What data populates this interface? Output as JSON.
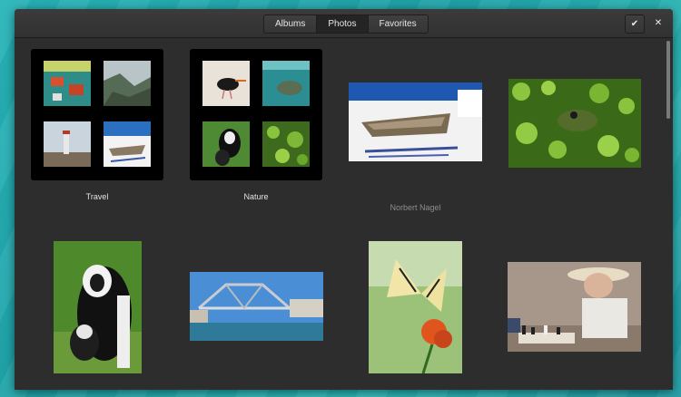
{
  "tabs": [
    {
      "label": "Albums"
    },
    {
      "label": "Photos"
    },
    {
      "label": "Favorites"
    }
  ],
  "toolbar": {
    "select_icon": "checkmark-icon",
    "close_icon": "close-icon",
    "select_glyph": "✔",
    "close_glyph": "✕"
  },
  "albums": [
    {
      "name": "Travel"
    },
    {
      "name": "Nature"
    }
  ],
  "photos": [
    {
      "name": "rowboat-photo"
    },
    {
      "name": "frog-photo",
      "caption": "Norbert Nagel"
    },
    {
      "name": "monkey-photo"
    },
    {
      "name": "bridge-photo"
    },
    {
      "name": "butterfly-photo"
    },
    {
      "name": "chess-player-photo"
    }
  ],
  "colors": {
    "desktop": "#28b4b8",
    "window": "#2d2d2d",
    "headerbar": "#353535"
  }
}
